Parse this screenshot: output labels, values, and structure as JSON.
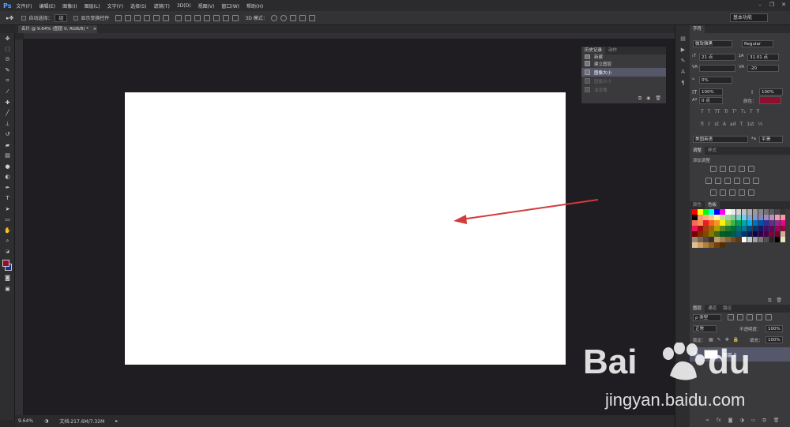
{
  "app": {
    "logo": "Ps",
    "workspace": "基本功能"
  },
  "menu": [
    "文件(F)",
    "编辑(E)",
    "图像(I)",
    "图层(L)",
    "文字(Y)",
    "选择(S)",
    "滤镜(T)",
    "3D(D)",
    "视图(V)",
    "窗口(W)",
    "帮助(H)"
  ],
  "options_bar": {
    "auto_select_label": "自动选择：",
    "auto_select_value": "组",
    "show_transform_label": "显示变换控件",
    "mode_3d_label": "3D 模式："
  },
  "document": {
    "tab_title": "名片 @ 9.64% (图层 0, RGB/8) *"
  },
  "status": {
    "zoom": "9.64%",
    "doc_info": "文档:217.6M/7.32M"
  },
  "history": {
    "tabs": [
      "历史记录",
      "动作"
    ],
    "items": [
      {
        "label": "新建",
        "state": "normal"
      },
      {
        "label": "建立图层",
        "state": "normal"
      },
      {
        "label": "图像大小",
        "state": "selected"
      },
      {
        "label": "图像大小",
        "state": "dim"
      },
      {
        "label": "油漆桶",
        "state": "dim"
      }
    ]
  },
  "character": {
    "tab": "字符",
    "font_family": "微软雅黑",
    "font_style": "Regular",
    "size": "21 点",
    "leading": "31.01 点",
    "tracking": "-20",
    "scale_pct": "0%",
    "vscale": "100%",
    "hscale": "100%",
    "baseline": "0 点",
    "color_label": "颜色：",
    "color": "#8e0f2e",
    "glyphs": [
      "T",
      "T",
      "TT",
      "Tr",
      "T¹",
      "T₁",
      "T",
      "Ŧ"
    ],
    "glyphs2": [
      "fi",
      "ℰ",
      "st",
      "A",
      "ad",
      "T",
      "1st",
      "½"
    ],
    "language": "美国英语",
    "aa_label": "ªa",
    "aa_value": "平滑"
  },
  "adjustments": {
    "tabs": [
      "调整",
      "样式"
    ],
    "title": "添加调整"
  },
  "swatches": {
    "tabs": [
      "颜色",
      "色板"
    ]
  },
  "layers": {
    "tabs": [
      "图层",
      "通道",
      "路径"
    ],
    "filter_label": "ρ 类型",
    "blend_mode": "正常",
    "opacity_label": "不透明度：",
    "opacity": "100%",
    "lock_label": "锁定：",
    "fill_label": "填充：",
    "fill": "100%",
    "layer_name": "图层 0"
  },
  "watermark": {
    "brand": "Bai",
    "brand2": "du",
    "site": "jingyan.baidu.com"
  },
  "colors": {
    "accent_red": "#d23b3b",
    "foreground": "#8e0f2e",
    "background": "#1b2f8c"
  }
}
